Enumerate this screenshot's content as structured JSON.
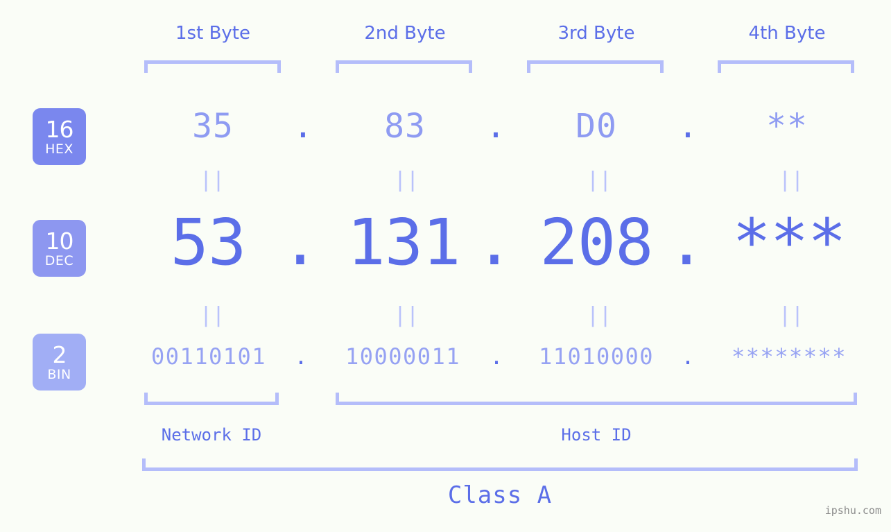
{
  "background_color": "#fafdf7",
  "accent_color": "#5b6ee8",
  "accent_light_color": "#b4bdfa",
  "headers": {
    "byte1": "1st Byte",
    "byte2": "2nd Byte",
    "byte3": "3rd Byte",
    "byte4": "4th Byte"
  },
  "bases": [
    {
      "number": "16",
      "name": "HEX",
      "color": "#7a87ee"
    },
    {
      "number": "10",
      "name": "DEC",
      "color": "#8d97f0"
    },
    {
      "number": "2",
      "name": "BIN",
      "color": "#a1aef5"
    }
  ],
  "rows": {
    "hex": {
      "label_number": "16",
      "label_name": "HEX",
      "octets": [
        "35",
        "83",
        "D0",
        "**"
      ],
      "separator": "."
    },
    "dec": {
      "label_number": "10",
      "label_name": "DEC",
      "octets": [
        "53",
        "131",
        "208",
        "***"
      ],
      "separator": "."
    },
    "bin": {
      "label_number": "2",
      "label_name": "BIN",
      "octets": [
        "00110101",
        "10000011",
        "11010000",
        "********"
      ],
      "separator": "."
    }
  },
  "equals_glyph": "||",
  "segments": {
    "network_id": "Network ID",
    "host_id": "Host ID",
    "class": "Class A"
  },
  "watermark": "ipshu.com"
}
